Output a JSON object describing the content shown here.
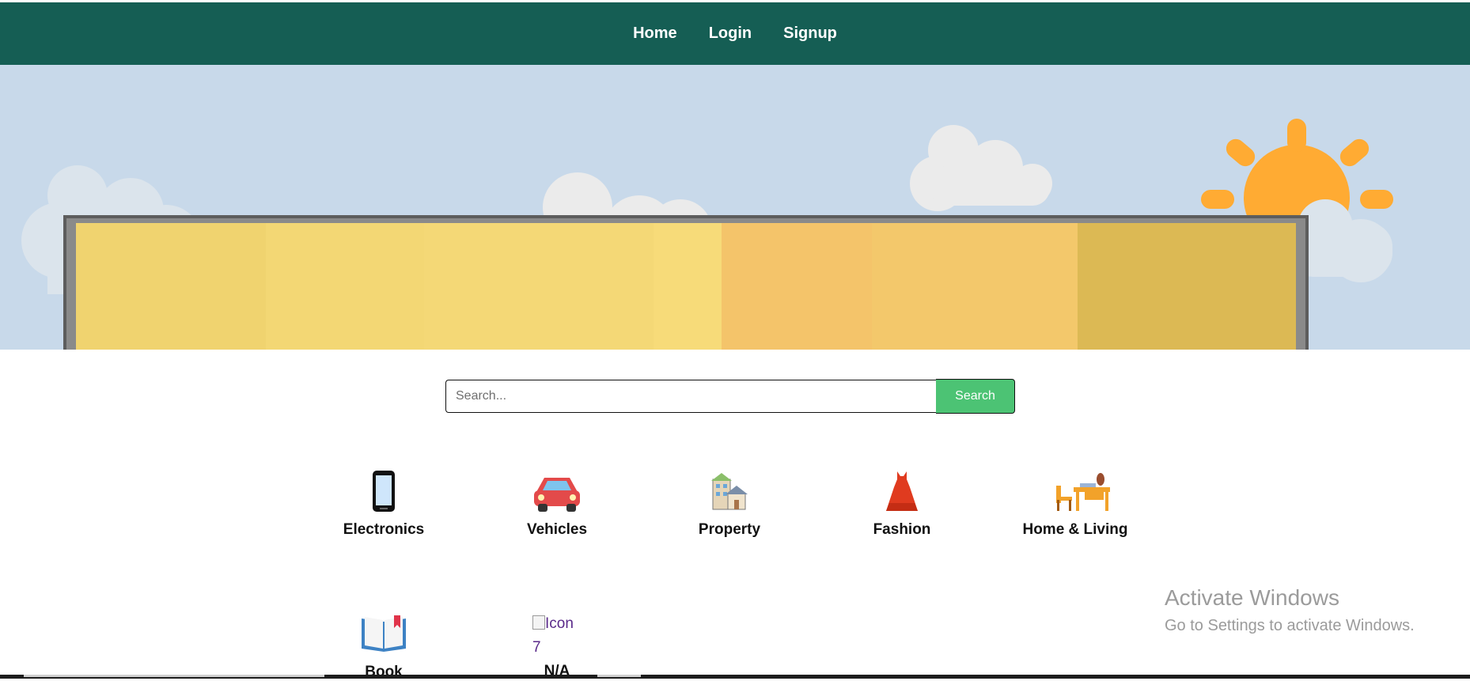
{
  "nav": {
    "items": [
      {
        "label": "Home"
      },
      {
        "label": "Login"
      },
      {
        "label": "Signup"
      }
    ]
  },
  "hero": {
    "sky_color": "#c8d9ea",
    "sun_color": "#ffab33",
    "banner_colors": [
      "#f2d672",
      "#f6d977",
      "#f4c46a",
      "#dcb954"
    ]
  },
  "search": {
    "placeholder": "Search...",
    "button_label": "Search"
  },
  "categories": [
    {
      "label": "Electronics",
      "icon": "mobile-phone-icon"
    },
    {
      "label": "Vehicles",
      "icon": "car-icon"
    },
    {
      "label": "Property",
      "icon": "house-buildings-icon"
    },
    {
      "label": "Fashion",
      "icon": "dress-icon"
    },
    {
      "label": "Home & Living",
      "icon": "desk-chair-icon"
    },
    {
      "label": "Book",
      "icon": "open-book-icon"
    },
    {
      "label": "N/A",
      "icon": "broken-image-icon",
      "alt_line1": "Icon",
      "alt_line2": "7"
    }
  ],
  "watermark": {
    "title": "Activate Windows",
    "subtitle": "Go to Settings to activate Windows."
  }
}
